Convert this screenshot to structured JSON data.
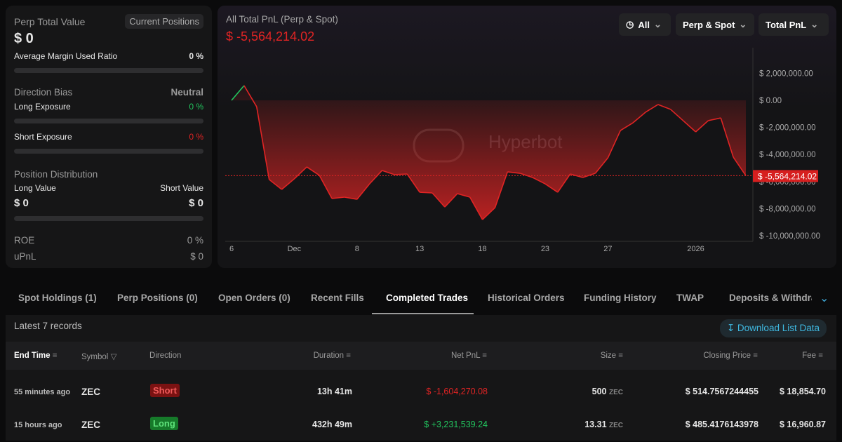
{
  "left": {
    "title": "Perp Total Value",
    "current_btn": "Current Positions",
    "total": "$ 0",
    "margin_label": "Average Margin Used Ratio",
    "margin_value": "0 %",
    "margin_ratio": 0,
    "bias_label": "Direction Bias",
    "bias_value": "Neutral",
    "long_exp_label": "Long Exposure",
    "long_exp_value": "0 %",
    "short_exp_label": "Short Exposure",
    "short_exp_value": "0 %",
    "dist_label": "Position Distribution",
    "long_value_label": "Long Value",
    "short_value_label": "Short Value",
    "long_value": "$ 0",
    "short_value": "$ 0",
    "roe_label": "ROE",
    "roe_value": "0 %",
    "upnl_label": "uPnL",
    "upnl_value": "$ 0"
  },
  "chart_header": {
    "title": "All Total PnL (Perp & Spot)",
    "value": "$ -5,564,214.02",
    "filters": [
      "All",
      "Perp & Spot",
      "Total PnL"
    ],
    "watermark": "Hyperbot"
  },
  "chart_data": {
    "type": "area",
    "ylim": [
      -10000000,
      3000000
    ],
    "yticks": [
      {
        "v": 2000000,
        "label": "$ 2,000,000.00"
      },
      {
        "v": 0,
        "label": "$ 0.00"
      },
      {
        "v": -2000000,
        "label": "$ -2,000,000.00"
      },
      {
        "v": -4000000,
        "label": "$ -4,000,000.00"
      },
      {
        "v": -6000000,
        "label": "$ -6,000,000.00"
      },
      {
        "v": -8000000,
        "label": "$ -8,000,000.00"
      },
      {
        "v": -10000000,
        "label": "$ -10,000,000.00"
      }
    ],
    "xticks": [
      {
        "i": 0,
        "label": "6"
      },
      {
        "i": 5,
        "label": "Dec"
      },
      {
        "i": 10,
        "label": "8"
      },
      {
        "i": 15,
        "label": "13"
      },
      {
        "i": 20,
        "label": "18"
      },
      {
        "i": 25,
        "label": "23"
      },
      {
        "i": 30,
        "label": "27"
      },
      {
        "i": 37,
        "label": "2026"
      }
    ],
    "values": [
      0,
      1090000,
      -470000,
      -5850000,
      -6580000,
      -5800000,
      -4920000,
      -5540000,
      -7250000,
      -7150000,
      -7310000,
      -6170000,
      -5180000,
      -5490000,
      -5440000,
      -6790000,
      -6840000,
      -7880000,
      -6890000,
      -7150000,
      -8810000,
      -7930000,
      -5280000,
      -5390000,
      -5700000,
      -6170000,
      -6790000,
      -5440000,
      -5700000,
      -5390000,
      -4250000,
      -2230000,
      -1660000,
      -880000,
      -310000,
      -670000,
      -1500000,
      -2330000,
      -1500000,
      -1300000,
      -4200000,
      -5564214.02
    ],
    "current": {
      "v": -5564214.02,
      "label": "$ -5,564,214.02"
    },
    "colors": {
      "negative": "#e02424",
      "positive": "#22c55e"
    }
  },
  "tabs": [
    {
      "label": "Spot Holdings (1)"
    },
    {
      "label": "Perp Positions (0)"
    },
    {
      "label": "Open Orders (0)"
    },
    {
      "label": "Recent Fills"
    },
    {
      "label": "Completed Trades",
      "active": true
    },
    {
      "label": "Historical Orders"
    },
    {
      "label": "Funding History"
    },
    {
      "label": "TWAP"
    },
    {
      "label": "Deposits & Withdraw"
    }
  ],
  "table": {
    "records": "Latest 7 records",
    "download": "Download List Data",
    "columns": [
      "End Time",
      "Symbol",
      "Direction",
      "Duration",
      "Net PnL",
      "Size",
      "Closing Price",
      "Fee"
    ],
    "rows": [
      {
        "end": "55 minutes ago",
        "symbol": "ZEC",
        "direction": "Short",
        "duration": "13h 41m",
        "pnl": "$ -1,604,270.08",
        "size": "500",
        "unit": "ZEC",
        "price": "$ 514.7567244455",
        "fee": "$ 18,854.70"
      },
      {
        "end": "15 hours ago",
        "symbol": "ZEC",
        "direction": "Long",
        "duration": "432h 49m",
        "pnl": "$ +3,231,539.24",
        "size": "13.31",
        "unit": "ZEC",
        "price": "$ 485.4176143978",
        "fee": "$ 16,960.87"
      }
    ]
  }
}
